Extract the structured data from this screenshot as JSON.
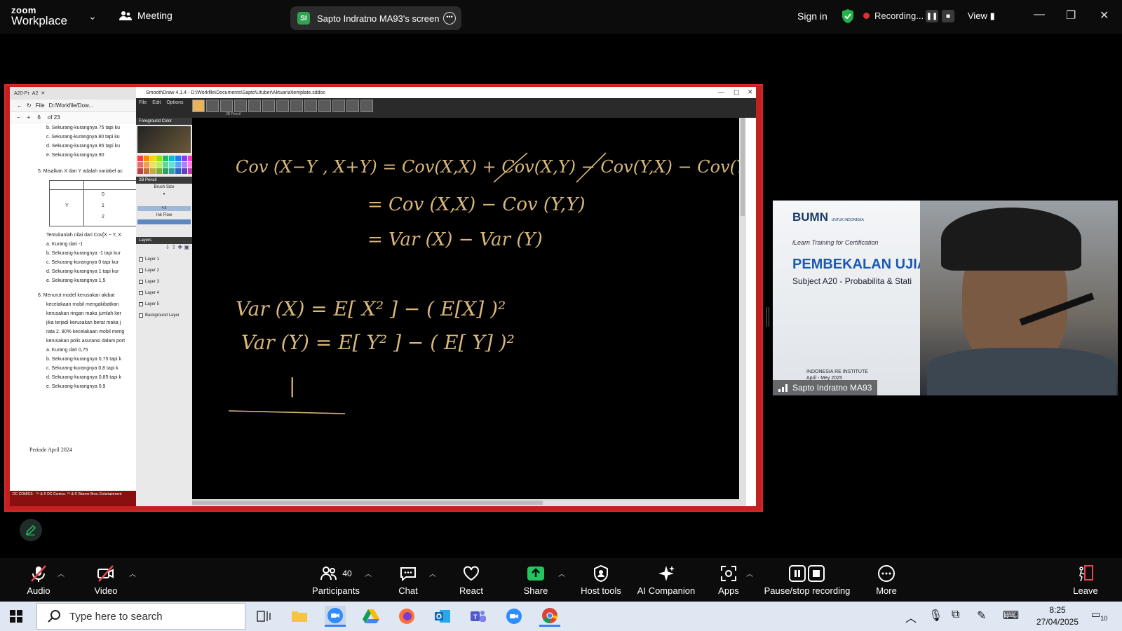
{
  "app": {
    "logo_line1": "zoom",
    "logo_line2": "Workplace",
    "meeting_label": "Meeting",
    "screen_badge": "SI",
    "screen_title": "Sapto Indratno MA93's screen",
    "sign_in": "Sign in",
    "recording_label": "Recording...",
    "view_label": "View"
  },
  "shared": {
    "pdf": {
      "tab1": "A20-Pr",
      "tab2": "A2",
      "file_label": "File",
      "path": "D:/Workfile/Dow...",
      "page": "6",
      "of_pages": "of 23",
      "lines_top": [
        "b.   Sekurang-kurangnya 75 tapi ku",
        "c.   Sekurang-kurangnya 80 tapi ku",
        "d.   Sekurang-kurangnya 85 tapi ku",
        "e.   Sekurang-kurangnya 90"
      ],
      "q5": "5.   Misalkan X dan Y adalah variabel ac",
      "table_cells": [
        "0",
        "1",
        "2",
        "Y"
      ],
      "q5b": "Tentukanlah nilai dari Cov[X − Y, X",
      "answers5": [
        "a.   Kurang dari -1",
        "b.   Sekurang-kurangnya -1 tapi kur",
        "c.   Sekurang-kurangnya 0 tapi kur",
        "d.   Sekurang-kurangnya 1 tapi kur",
        "e.   Sekurang-kurangnya 1,5"
      ],
      "q6": [
        "6.   Menurut model kerusakan akibat",
        "kecelakaan mobil mengakibatkan",
        "kerusakan ringan maka jumlah ker",
        "jika terjadi kerusakan berat maka j",
        "rata 2. 80% kecelakaan mobil meng",
        "kerusakan polis asuransi dalam port"
      ],
      "answers6": [
        "a.   Kurang dari 0,75",
        "b.   Sekurang-kurangnya 0,75 tapi k",
        "c.   Sekurang-kurangnya 0,8 tapi k",
        "d.   Sekurang-kurangnya 0,85 tapi k",
        "e.   Sekurang-kurangnya 0,9"
      ],
      "footer": "Periode April 2024",
      "banner": "DC COMICS · ™ & © DC Comics. ™ & © Warner Bros. Entertainment"
    },
    "smoothdraw": {
      "title": "SmoothDraw 4.1.4 - D:\\Workfile\\Documents\\Sapto\\Utuber\\Aktuaria\\template.sddoc",
      "menu": [
        "File",
        "Edit",
        "Options"
      ],
      "tool_name": "2B Pencil",
      "foreground_label": "Foreground Color",
      "pencil_label": "2B Pencil",
      "brush_size_label": "Brush Size",
      "brush_size_value": "4.0",
      "ink_flow_label": "Ink Flow",
      "layers_label": "Layers",
      "layers": [
        "Layer 1",
        "Layer 2",
        "Layer 3",
        "Layer 4",
        "Layer 5",
        "Background Layer"
      ],
      "ink_color": "#d9b77a",
      "handwriting": [
        "Cov (X−Y , X+Y) = Cov(X,X) + Cov(X,Y) − Cov(Y,X) − Cov(Y,Y)",
        "= Cov (X,X)  − Cov (Y,Y)",
        "= Var (X)  −  Var (Y)",
        "Var (X) = E[ X² ] − ( E[X] )²",
        "Var (Y) = E[ Y² ] − ( E[ Y] )²",
        "|"
      ]
    }
  },
  "video": {
    "slide_brand": "BUMN",
    "slide_brand_small": "UNTUK INDONESIA",
    "slide_subtitle": "iLearn Training for Certification",
    "slide_title": "PEMBEKALAN UJIA",
    "slide_subject": "Subject A20 - Probabilita & Stati",
    "slide_institute": "INDONESIA RE INSTITUTE",
    "slide_dates": "April - Mey 2025",
    "participant_name": "Sapto Indratno MA93"
  },
  "toolbar": {
    "audio": "Audio",
    "video": "Video",
    "participants": "Participants",
    "participants_count": "40",
    "chat": "Chat",
    "react": "React",
    "share": "Share",
    "host_tools": "Host tools",
    "ai_companion": "AI Companion",
    "apps": "Apps",
    "pause_recording": "Pause/stop recording",
    "more": "More",
    "leave": "Leave"
  },
  "taskbar": {
    "search_placeholder": "Type here to search",
    "time": "8:25",
    "date": "27/04/2025",
    "notifications": "10"
  },
  "colors": {
    "accent_green": "#24b34b",
    "recording_red": "#e02f2f",
    "share_green": "#22c55e",
    "leave_red": "#e5484d"
  }
}
